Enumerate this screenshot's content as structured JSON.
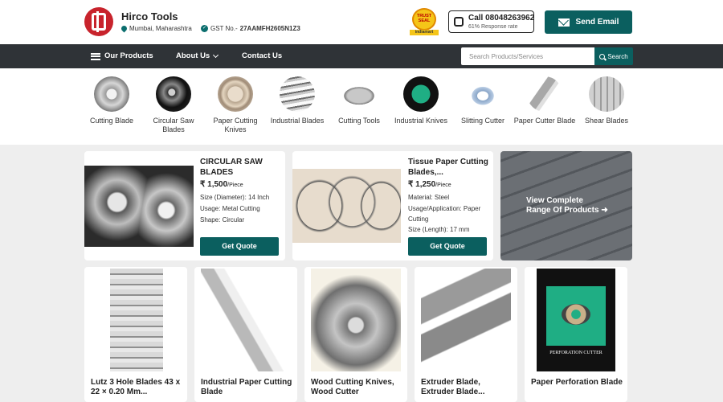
{
  "company": {
    "name": "Hirco Tools",
    "location": "Mumbai, Maharashtra",
    "gst_label": "GST No.-",
    "gst_number": "27AAMFH2605N1Z3"
  },
  "trust_seal": {
    "line1": "TRUST",
    "line2": "SEAL",
    "band": "indiamart"
  },
  "call": {
    "label": "Call 08048263962",
    "sub": "61% Response rate"
  },
  "email_button": "Send Email",
  "nav": {
    "our_products": "Our Products",
    "about_us": "About Us",
    "contact_us": "Contact Us",
    "search_placeholder": "Search Products/Services",
    "search_button": "Search"
  },
  "categories": [
    {
      "label": "Cutting Blade"
    },
    {
      "label": "Circular Saw Blades"
    },
    {
      "label": "Paper Cutting Knives"
    },
    {
      "label": "Industrial Blades"
    },
    {
      "label": "Cutting Tools"
    },
    {
      "label": "Industrial Knives"
    },
    {
      "label": "Slitting Cutter"
    },
    {
      "label": "Paper Cutter Blade"
    },
    {
      "label": "Shear Blades"
    }
  ],
  "featured": [
    {
      "title": "CIRCULAR SAW BLADES",
      "price": "₹ 1,500",
      "unit": "/Piece",
      "specs": [
        "Size (Diameter): 14 Inch",
        "Usage: Metal Cutting",
        "Shape: Circular"
      ],
      "button": "Get Quote"
    },
    {
      "title": "Tissue Paper Cutting Blades,...",
      "price": "₹ 1,250",
      "unit": "/Piece",
      "specs": [
        "Material: Steel",
        "Usage/Application: Paper Cutting",
        "Size (Length): 17 mm"
      ],
      "button": "Get Quote"
    }
  ],
  "range_card": {
    "line1": "View Complete",
    "line2": "Range Of Products ➜"
  },
  "products": [
    {
      "title": "Lutz 3 Hole Blades 43 x 22 × 0.20 Mm..."
    },
    {
      "title": "Industrial Paper Cutting Blade"
    },
    {
      "title": "Wood Cutting Knives, Wood Cutter"
    },
    {
      "title": "Extruder Blade, Extruder Blade..."
    },
    {
      "title": "Paper Perforation Blade"
    }
  ],
  "perforation_image_caption": "PERFORATION CUTTER",
  "colors": {
    "brand_teal": "#0b5f5f",
    "nav_dark": "#2f3337",
    "logo_red": "#c8232c"
  }
}
